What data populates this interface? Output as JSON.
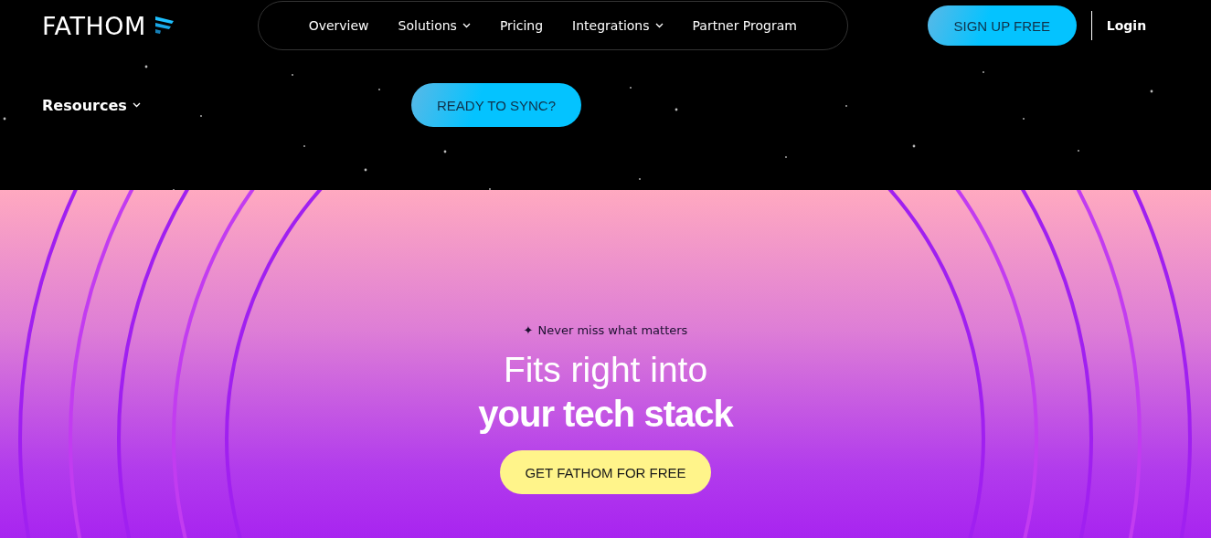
{
  "logo": {
    "text": "FATHOM"
  },
  "nav": [
    {
      "label": "Overview",
      "has_menu": false
    },
    {
      "label": "Solutions",
      "has_menu": true
    },
    {
      "label": "Pricing",
      "has_menu": false
    },
    {
      "label": "Integrations",
      "has_menu": true
    },
    {
      "label": "Partner Program",
      "has_menu": false
    },
    {
      "label": "Resources",
      "has_menu": true
    }
  ],
  "signup_button": "SIGN UP FREE",
  "login_link": "Login",
  "sync_button": "READY TO SYNC?",
  "hero": {
    "eyebrow_icon": "✦",
    "eyebrow": "Never miss what matters",
    "heading_line1": "Fits right into",
    "heading_line2": "your tech stack",
    "cta": "GET FATHOM FOR FREE"
  }
}
